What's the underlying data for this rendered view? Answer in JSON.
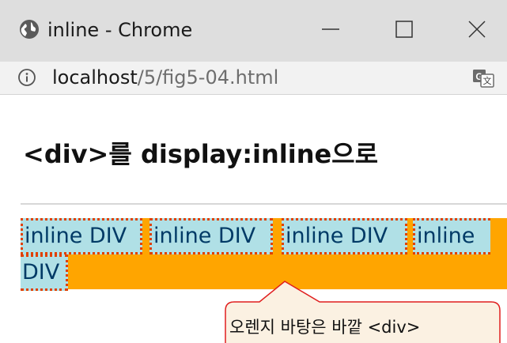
{
  "window": {
    "title": "inline - Chrome",
    "controls": [
      "minimize",
      "maximize",
      "close"
    ]
  },
  "address_bar": {
    "host": "localhost",
    "path": "/5/fig5-04.html"
  },
  "page": {
    "heading": "<div>를 display:inline으로",
    "inline_divs": [
      {
        "label": "inline DIV"
      },
      {
        "label": "inline DIV"
      },
      {
        "label": "inline DIV"
      },
      {
        "label": "inline"
      },
      {
        "label": "DIV"
      }
    ],
    "callout_text": "오렌지 바탕은 바깥 <div>"
  },
  "colors": {
    "outer_background": "#ffa500",
    "inline_background": "#b0e0e6",
    "inline_border": "#e04000",
    "callout_fill": "#fbf1e2",
    "callout_border": "#e01e1e"
  },
  "icons": {
    "app": "chrome-globe-icon",
    "info": "info-icon",
    "translate": "translate-icon"
  }
}
